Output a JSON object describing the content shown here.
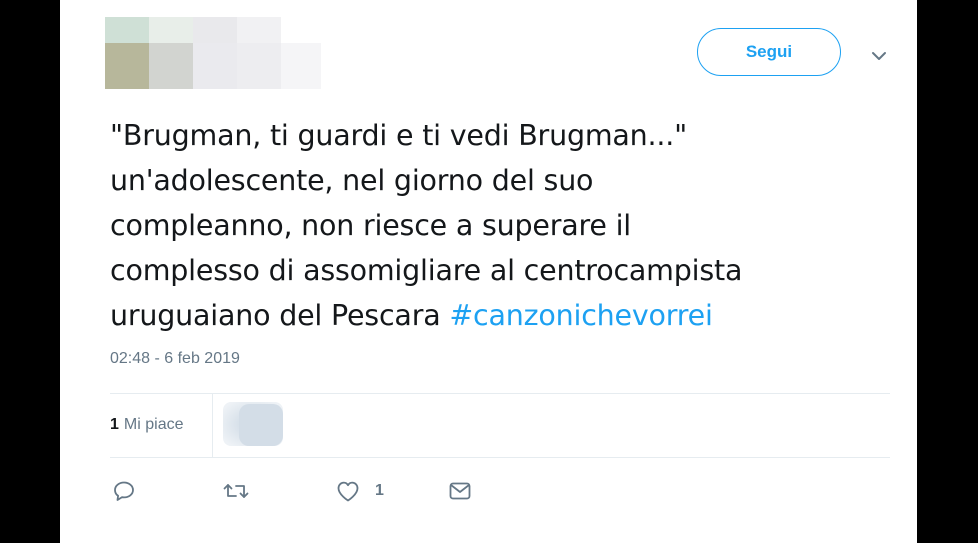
{
  "header": {
    "follow_label": "Segui",
    "chevron_icon": "chevron-down-icon"
  },
  "tweet": {
    "lines": [
      "\"Brugman, ti guardi e ti vedi Brugman...\"",
      "un'adolescente, nel giorno del suo",
      "compleanno, non riesce a superare il",
      "complesso di assomigliare al centrocampista",
      "uruguaiano del Pescara "
    ],
    "hashtag": "#canzonichevorrei",
    "timestamp": "02:48 - 6 feb 2019"
  },
  "stats": {
    "likes_count": "1",
    "likes_label": "Mi piace"
  },
  "actions": {
    "reply_icon": "reply-icon",
    "retweet_icon": "retweet-icon",
    "like_icon": "heart-icon",
    "like_count": "1",
    "dm_icon": "mail-icon"
  },
  "colors": {
    "accent": "#1da1f2",
    "text": "#14171a",
    "muted": "#657786",
    "divider": "#e6ecf0"
  }
}
